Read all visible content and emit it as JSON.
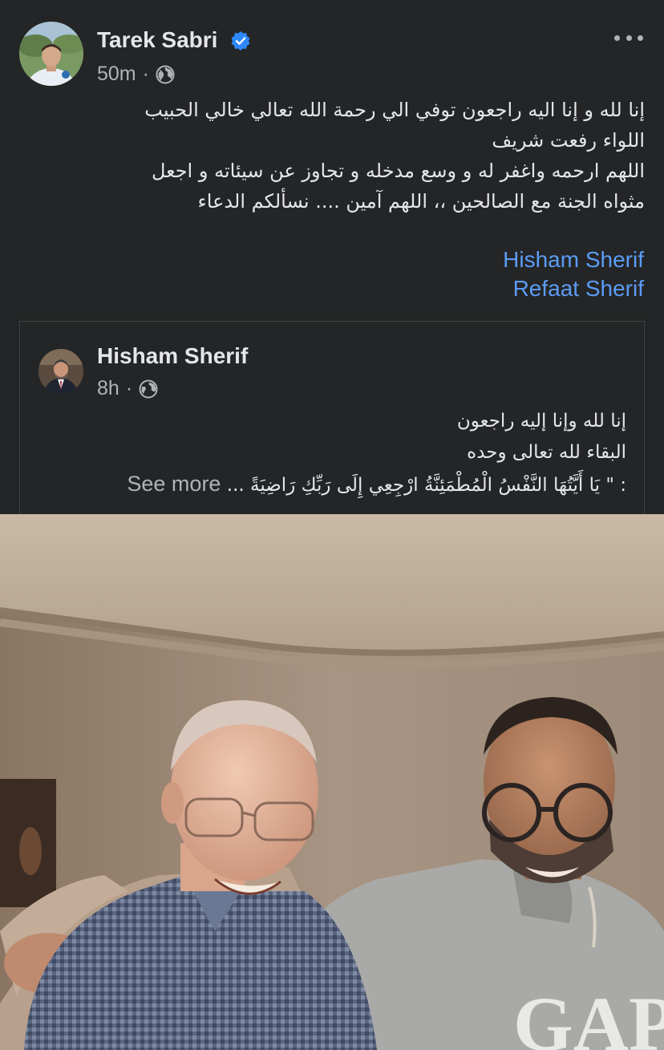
{
  "post": {
    "author": "Tarek Sabri",
    "time": "50m",
    "separator": "·",
    "verified": true,
    "privacy_icon": "globe-icon",
    "more_icon": "more-options-icon",
    "text_lines": [
      "إنا لله و إنا اليه راجعون توفي الي رحمة الله تعالي خالي الحبيب",
      "اللواء رفعت شريف",
      "اللهم ارحمه واغفر له و وسع مدخله و تجاوز عن سيئاته و اجعل",
      "مثواه الجنة مع الصالحين ،، اللهم آمين .... نسألكم الدعاء"
    ],
    "mentions": [
      "Hisham Sherif",
      "Refaat Sherif"
    ]
  },
  "shared_post": {
    "author": "Hisham Sherif",
    "time": "8h",
    "separator": "·",
    "privacy_icon": "globe-icon",
    "text_lines": [
      "إنا لله وإنا إليه راجعون",
      "البقاء لله تعالى وحده",
      ": \" يَا أَيَّتُهَا النَّفْسُ الْمُطْمَئِنَّةُ ارْجِعِي إِلَى رَبِّكِ رَاضِيَةً ..."
    ],
    "see_more": "See more"
  },
  "photo": {
    "shirt_text": "GAP"
  },
  "colors": {
    "background": "#242526",
    "text": "#e4e6eb",
    "secondary": "#b0b3b8",
    "link": "#5b9cf6",
    "verified": "#2d88ff",
    "border": "#3e4042"
  }
}
